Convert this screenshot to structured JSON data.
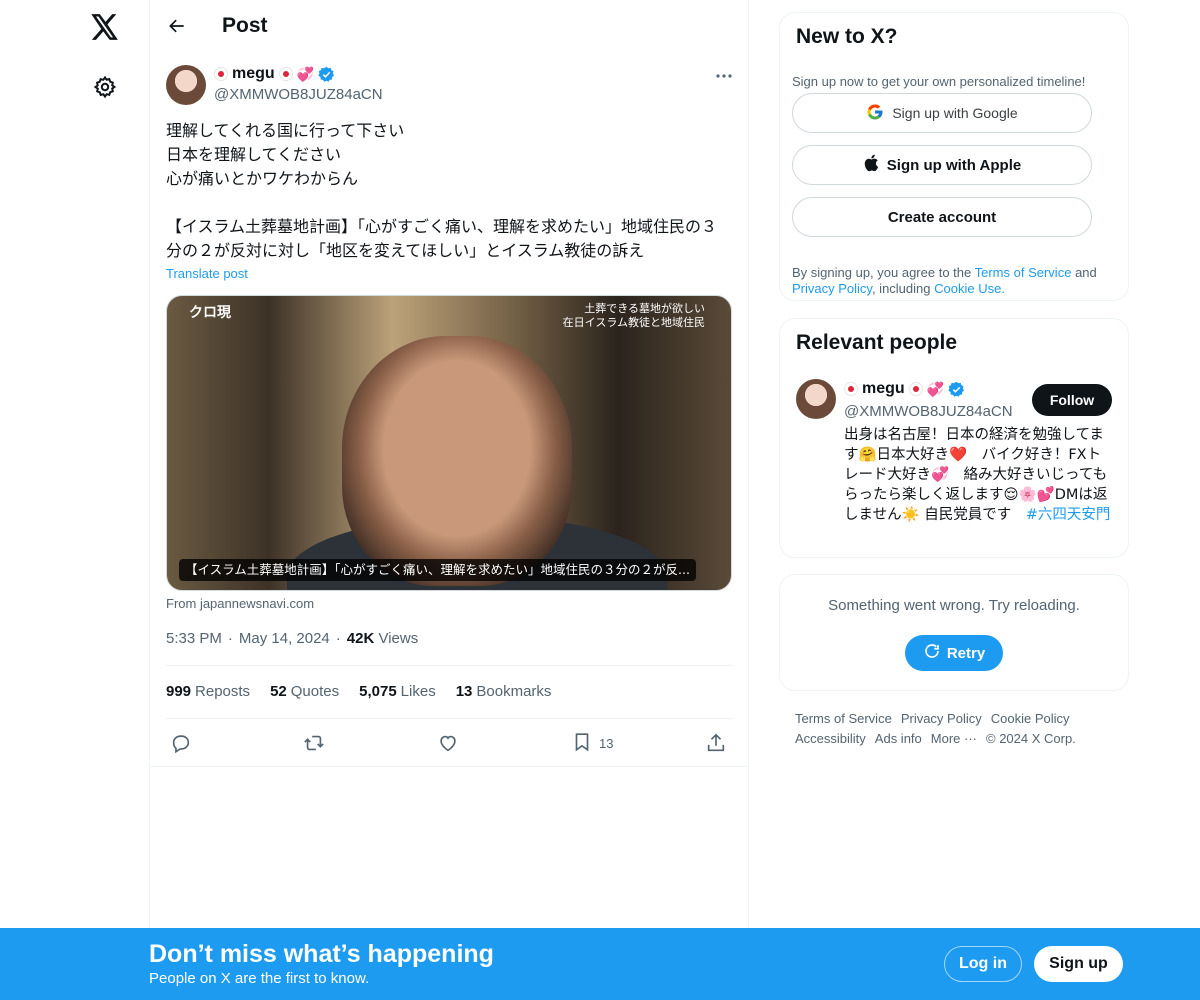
{
  "nav": {
    "logo_icon": "x-logo-icon",
    "settings_icon": "gear-icon"
  },
  "header": {
    "title": "Post"
  },
  "post": {
    "author": {
      "name": "megu",
      "handle": "@XMMWOB8JUZ84aCN"
    },
    "text": "理解してくれる国に行って下さい\n日本を理解してください\n心が痛いとかワケわからん\n\n【イスラム土葬墓地計画】「心がすごく痛い、理解を求めたい」地域住民の３分の２が反対に対し「地区を変えてほしい」とイスラム教徒の訴え",
    "translate": "Translate post",
    "media": {
      "corner_left": "クロ現",
      "corner_right_line1": "土葬できる墓地が欲しい",
      "corner_right_line2": "在日イスラム教徒と地域住民",
      "caption": "【イスラム土葬墓地計画】「心がすごく痛い、理解を求めたい」地域住民の３分の２が反..."
    },
    "source": "From japannewsnavi.com",
    "time": "5:33 PM",
    "date": "May 14, 2024",
    "views_count": "42K",
    "views_label": "Views",
    "stats": {
      "reposts": "999",
      "reposts_label": "Reposts",
      "quotes": "52",
      "quotes_label": "Quotes",
      "likes": "5,075",
      "likes_label": "Likes",
      "bookmarks": "13",
      "bookmarks_label": "Bookmarks"
    },
    "actions": {
      "bookmark_count": "13"
    }
  },
  "signup": {
    "title": "New to X?",
    "subtitle": "Sign up now to get your own personalized timeline!",
    "google": "Sign up with Google",
    "apple": "Sign up with Apple",
    "create": "Create account",
    "legal_prefix": "By signing up, you agree to the",
    "terms": "Terms of Service",
    "and": "and",
    "privacy": "Privacy Policy",
    "including": ", including",
    "cookie": "Cookie Use."
  },
  "people": {
    "title": "Relevant people",
    "name": "megu",
    "handle": "@XMMWOB8JUZ84aCN",
    "follow": "Follow",
    "bio_text": "出身は名古屋！日本の経済を勉強してます🤗日本大好き❤️　バイク好き！FXトレード大好き💞　絡み大好きいじってもらったら楽しく返します😌🌸💕DMは返しません☀️ 自民党員です　",
    "bio_tag": "#六四天安門"
  },
  "error": {
    "message": "Something went wrong. Try reloading.",
    "retry": "Retry"
  },
  "footer": {
    "terms": "Terms of Service",
    "privacy": "Privacy Policy",
    "cookie": "Cookie Policy",
    "accessibility": "Accessibility",
    "ads": "Ads info",
    "more": "More ···",
    "copyright": "© 2024 X Corp."
  },
  "banner": {
    "title": "Don’t miss what’s happening",
    "subtitle": "People on X are the first to know.",
    "login": "Log in",
    "signup": "Sign up"
  },
  "colors": {
    "accent": "#1d9bf0",
    "text": "#0f1419",
    "muted": "#536471"
  }
}
